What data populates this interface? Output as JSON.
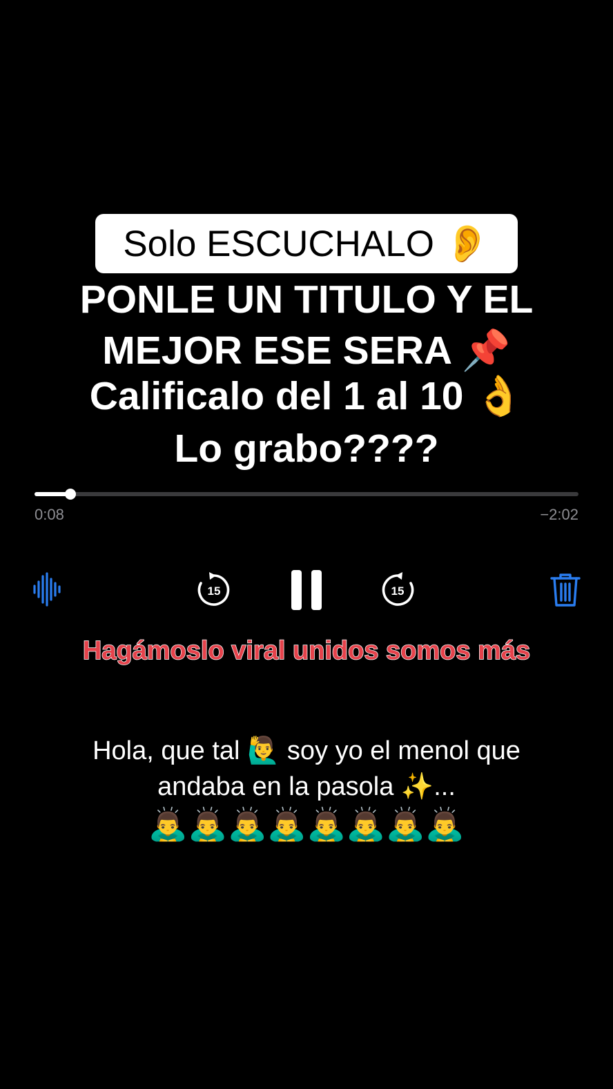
{
  "title_badge": {
    "text": "Solo ESCUCHALO 👂"
  },
  "overlay": {
    "line1": "PONLE UN TITULO Y EL",
    "line2": "MEJOR ESE SERA 📌",
    "line3": "Calificalo del 1 al 10 👌",
    "line4": "Lo grabo????"
  },
  "player": {
    "elapsed": "0:08",
    "remaining": "−2:02",
    "progress_fraction": 0.066,
    "skip_back_seconds": "15",
    "skip_forward_seconds": "15",
    "icons": {
      "waveform": "waveform-icon",
      "skip_back": "skip-back-15-icon",
      "pause": "pause-icon",
      "skip_forward": "skip-forward-15-icon",
      "trash": "trash-icon"
    },
    "colors": {
      "accent": "#2a7df0",
      "track": "#3a3a3c",
      "time": "#8e8e93"
    }
  },
  "caption": {
    "text": "Hagámoslo viral unidos somos más",
    "color": "#e5424b"
  },
  "description": {
    "line1": "Hola, que tal 🙋‍♂️ soy yo el menol que",
    "line2": "andaba en la pasola ✨...",
    "line3": "🙇‍♂️🙇‍♂️🙇‍♂️🙇‍♂️🙇‍♂️🙇‍♂️🙇‍♂️🙇‍♂️"
  }
}
